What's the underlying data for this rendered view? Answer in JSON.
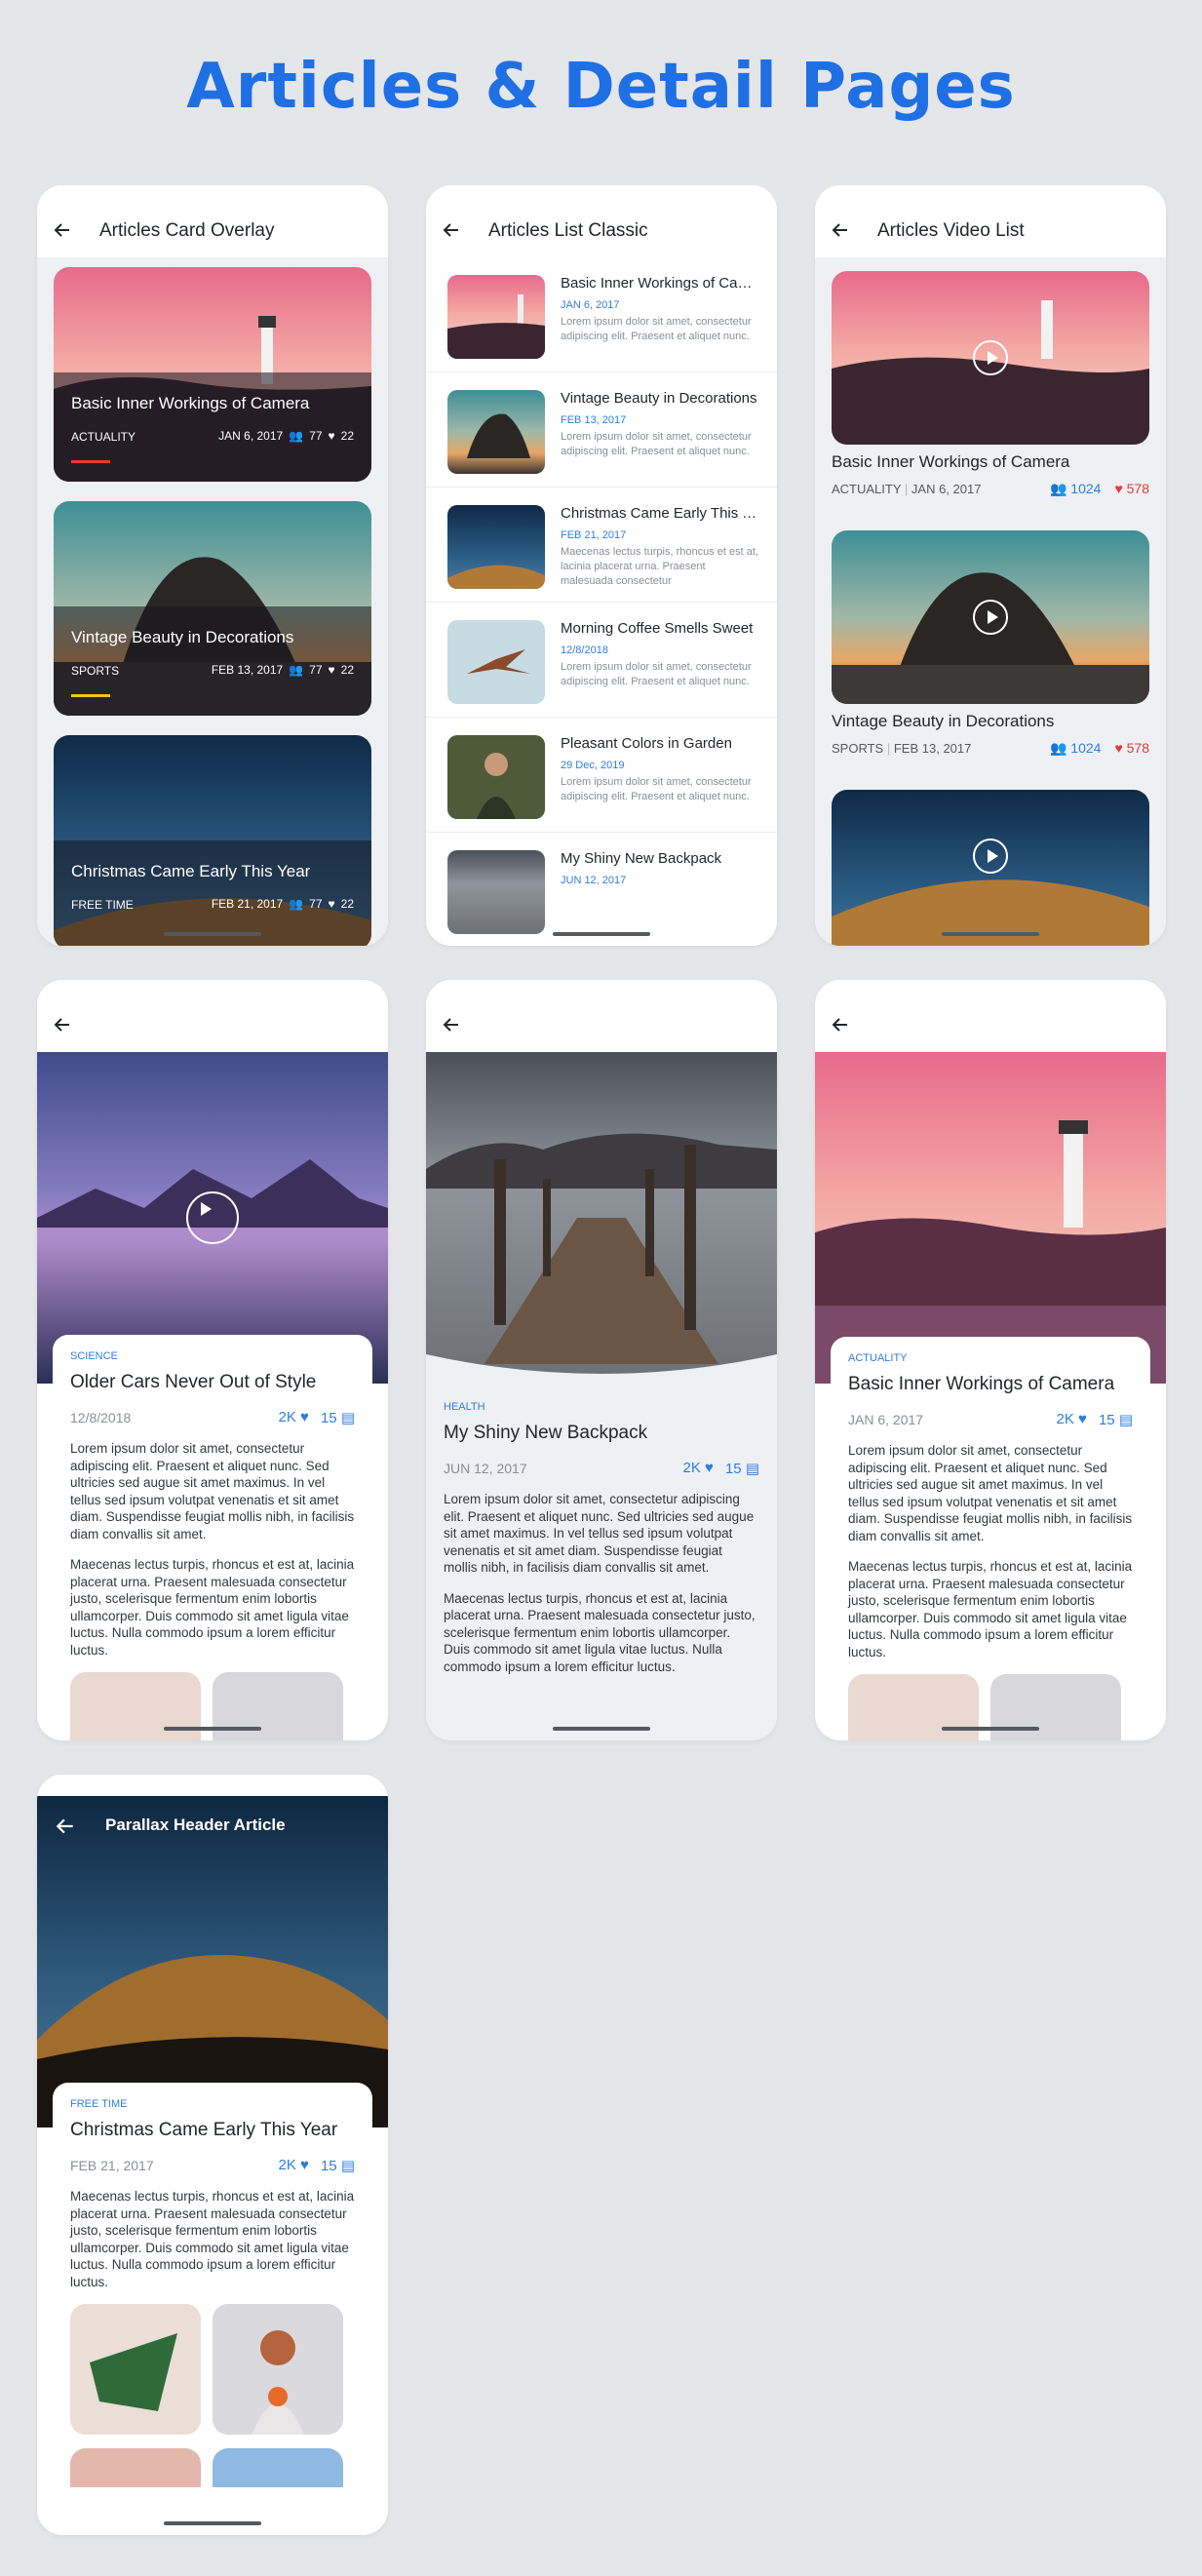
{
  "header": {
    "title": "Articles & Detail Pages"
  },
  "screen1": {
    "title": "Articles Card Overlay",
    "cards": [
      {
        "title": "Basic Inner Workings of Camera",
        "category": "ACTUALITY",
        "date": "JAN 6, 2017",
        "people": "77",
        "likes": "22",
        "accent": "#e53935"
      },
      {
        "title": "Vintage Beauty in Decorations",
        "category": "SPORTS",
        "date": "FEB 13, 2017",
        "people": "77",
        "likes": "22",
        "accent": "#f5c518"
      },
      {
        "title": "Christmas Came Early This Year",
        "category": "FREE TIME",
        "date": "FEB 21, 2017",
        "people": "77",
        "likes": "22",
        "accent": "#1f6fe5"
      }
    ]
  },
  "screen2": {
    "title": "Articles List Classic",
    "items": [
      {
        "title": "Basic Inner Workings of Camera",
        "date": "JAN 6, 2017",
        "excerpt": "Lorem ipsum dolor sit amet, consectetur adipiscing elit. Praesent et aliquet nunc."
      },
      {
        "title": "Vintage Beauty in Decorations",
        "date": "FEB 13, 2017",
        "excerpt": "Lorem ipsum dolor sit amet, consectetur adipiscing elit. Praesent et aliquet nunc."
      },
      {
        "title": "Christmas Came Early This Year",
        "date": "FEB 21, 2017",
        "excerpt": "Maecenas lectus turpis, rhoncus et est at, lacinia placerat urna. Praesent malesuada consectetur"
      },
      {
        "title": "Morning Coffee Smells Sweet",
        "date": "12/8/2018",
        "excerpt": "Lorem ipsum dolor sit amet, consectetur adipiscing elit. Praesent et aliquet nunc."
      },
      {
        "title": "Pleasant Colors in Garden",
        "date": "29 Dec, 2019",
        "excerpt": "Lorem ipsum dolor sit amet, consectetur adipiscing elit. Praesent et aliquet nunc."
      },
      {
        "title": "My Shiny New Backpack",
        "date": "JUN 12, 2017",
        "excerpt": ""
      }
    ]
  },
  "screen3": {
    "title": "Articles Video List",
    "items": [
      {
        "title": "Basic Inner Workings of Camera",
        "category": "ACTUALITY",
        "date": "JAN 6, 2017",
        "views": "1024",
        "likes": "578"
      },
      {
        "title": "Vintage Beauty in Decorations",
        "category": "SPORTS",
        "date": "FEB 13, 2017",
        "views": "1024",
        "likes": "578"
      }
    ]
  },
  "detail1": {
    "category": "SCIENCE",
    "title": "Older Cars Never Out of Style",
    "date": "12/8/2018",
    "likes": "2K",
    "comments": "15",
    "p1": "Lorem ipsum dolor sit amet, consectetur adipiscing elit. Praesent et aliquet nunc. Sed ultricies sed augue sit amet maximus. In vel tellus sed ipsum volutpat venenatis et sit amet diam. Suspendisse feugiat mollis nibh, in facilisis diam convallis sit amet.",
    "p2": "Maecenas lectus turpis, rhoncus et est at, lacinia placerat urna. Praesent malesuada consectetur justo, scelerisque fermentum enim lobortis ullamcorper. Duis commodo sit amet ligula vitae luctus. Nulla commodo ipsum a lorem efficitur luctus."
  },
  "detail2": {
    "category": "HEALTH",
    "title": "My Shiny New Backpack",
    "date": "JUN 12, 2017",
    "likes": "2K",
    "comments": "15",
    "p1": "Lorem ipsum dolor sit amet, consectetur adipiscing elit. Praesent et aliquet nunc. Sed ultricies sed augue sit amet maximus. In vel tellus sed ipsum volutpat venenatis et sit amet diam. Suspendisse feugiat mollis nibh, in facilisis diam convallis sit amet.",
    "p2": "Maecenas lectus turpis, rhoncus et est at, lacinia placerat urna. Praesent malesuada consectetur justo, scelerisque fermentum enim lobortis ullamcorper. Duis commodo sit amet ligula vitae luctus. Nulla commodo ipsum a lorem efficitur luctus."
  },
  "detail3": {
    "category": "ACTUALITY",
    "title": "Basic Inner Workings of Camera",
    "date": "JAN 6, 2017",
    "likes": "2K",
    "comments": "15",
    "p1": "Lorem ipsum dolor sit amet, consectetur adipiscing elit. Praesent et aliquet nunc. Sed ultricies sed augue sit amet maximus. In vel tellus sed ipsum volutpat venenatis et sit amet diam. Suspendisse feugiat mollis nibh, in facilisis diam convallis sit amet.",
    "p2": "Maecenas lectus turpis, rhoncus et est at, lacinia placerat urna. Praesent malesuada consectetur justo, scelerisque fermentum enim lobortis ullamcorper. Duis commodo sit amet ligula vitae luctus. Nulla commodo ipsum a lorem efficitur luctus."
  },
  "detail4": {
    "header_title": "Parallax Header Article",
    "category": "FREE TIME",
    "title": "Christmas Came Early This Year",
    "date": "FEB 21, 2017",
    "likes": "2K",
    "comments": "15",
    "p1": "Maecenas lectus turpis, rhoncus et est at, lacinia placerat urna. Praesent malesuada consectetur justo, scelerisque fermentum enim lobortis ullamcorper. Duis commodo sit amet ligula vitae luctus. Nulla commodo ipsum a lorem efficitur luctus."
  },
  "colors": {
    "accent": "#1f6fe5",
    "link": "#2f7de0",
    "like": "#e53935"
  },
  "icons": [
    "back-arrow-icon",
    "people-icon",
    "heart-icon",
    "play-icon",
    "comment-icon"
  ]
}
